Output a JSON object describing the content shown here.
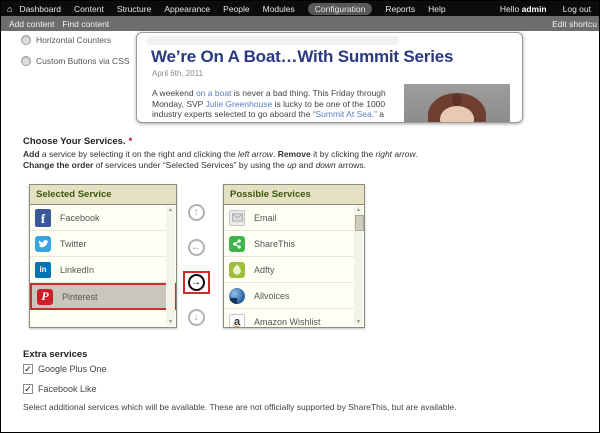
{
  "toolbar": {
    "items": [
      "Dashboard",
      "Content",
      "Structure",
      "Appearance",
      "People",
      "Modules",
      "Configuration",
      "Reports",
      "Help"
    ],
    "active_item": "Configuration",
    "greeting_prefix": "Hello ",
    "username": "admin",
    "logout_label": "Log out"
  },
  "shortcut_bar": {
    "items": [
      "Add content",
      "Find content"
    ],
    "right_label": "Edit shortcu"
  },
  "options": {
    "radios": [
      {
        "label": "Horizontal Counters",
        "selected": false
      },
      {
        "label": "Custom Buttons via CSS",
        "selected": false
      }
    ]
  },
  "preview": {
    "title": "We’re On A Boat…With Summit Series",
    "date": "April 6th, 2011",
    "paragraph": [
      {
        "text": "A weekend ",
        "link": false
      },
      {
        "text": "on a boat",
        "link": true
      },
      {
        "text": " is never a bad thing. This Friday through Monday, SVP ",
        "link": false
      },
      {
        "text": "Julie Greenhouse",
        "link": true
      },
      {
        "text": " is lucky to be one of the 1000 industry experts selected to go aboard the ",
        "link": false
      },
      {
        "text": "“Summit At Sea.”",
        "link": true
      },
      {
        "text": " a",
        "link": false
      }
    ]
  },
  "services": {
    "heading": "Choose Your Services.",
    "required_mark": "*",
    "help1": {
      "b1": "Add",
      "t1": " a service by selecting it on the right and clicking the ",
      "i1": "left arrow",
      "t2": ". ",
      "b2": "Remove",
      "t3": " it by clicking the ",
      "i2": "right arrow",
      "t4": "."
    },
    "help2": {
      "b1": "Change the order",
      "t1": " of services under “Selected Services” by using the ",
      "i1": "up",
      "t2": " and ",
      "i2": "down",
      "t3": " arrows."
    },
    "selected": {
      "header": "Selected Service",
      "items": [
        {
          "name": "Facebook",
          "icon": "facebook-icon",
          "selected": false
        },
        {
          "name": "Twitter",
          "icon": "twitter-icon",
          "selected": false
        },
        {
          "name": "LinkedIn",
          "icon": "linkedin-icon",
          "selected": false
        },
        {
          "name": "Pinterest",
          "icon": "pinterest-icon",
          "selected": true
        }
      ]
    },
    "possible": {
      "header": "Possible Services",
      "items": [
        {
          "name": "Email",
          "icon": "email-icon",
          "selected": false
        },
        {
          "name": "ShareThis",
          "icon": "sharethis-icon",
          "selected": false
        },
        {
          "name": "Adfty",
          "icon": "adfty-icon",
          "selected": false
        },
        {
          "name": "Allvoices",
          "icon": "allvoices-icon",
          "selected": false
        },
        {
          "name": "Amazon Wishlist",
          "icon": "amazon-wishlist-icon",
          "selected": false
        }
      ]
    },
    "arrows": {
      "up": {
        "glyph": "↑",
        "highlighted": false
      },
      "left": {
        "glyph": "←",
        "highlighted": false
      },
      "right": {
        "glyph": "→",
        "highlighted": true
      },
      "down": {
        "glyph": "↓",
        "highlighted": false
      }
    }
  },
  "extra": {
    "heading": "Extra services",
    "checkboxes": [
      {
        "label": "Google Plus One",
        "checked": true
      },
      {
        "label": "Facebook Like",
        "checked": true
      }
    ],
    "description": "Select additional services which will be available. These are not officially supported by ShareThis, but are available."
  },
  "glyphs": {
    "home": "⌂",
    "check": "✓",
    "scroll_up": "▲",
    "scroll_down": "▼",
    "icon_letters": {
      "facebook": "f",
      "linkedin": "in",
      "pinterest": "P",
      "amazon": "a"
    }
  },
  "colors": {
    "toolbar_bg": "#0c0c0c",
    "shortcut_bg": "#6d6d6d",
    "box_header_bg": "#e3e0c3",
    "box_header_text": "#41570d",
    "highlight_red": "#c53030",
    "headline_blue": "#293a80",
    "link_blue": "#5a7fc0"
  }
}
